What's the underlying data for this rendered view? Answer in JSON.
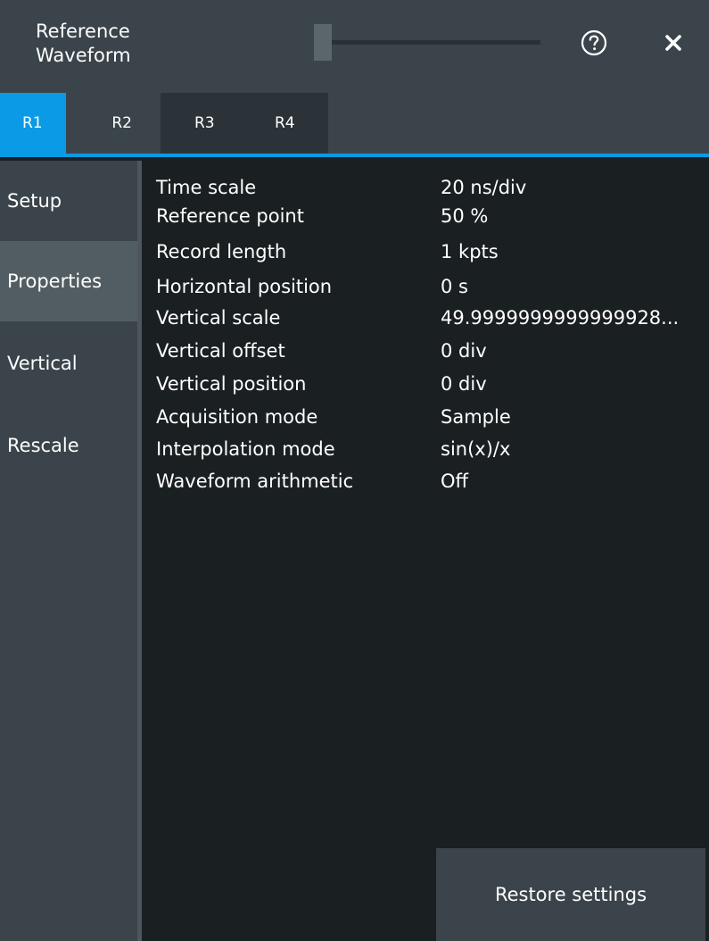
{
  "window": {
    "title_line1": "Reference",
    "title_line2": "Waveform",
    "help_icon": "help-circle-icon",
    "close_icon": "close-icon"
  },
  "tabs": [
    {
      "label": "R1",
      "active": true
    },
    {
      "label": "R2",
      "active": false
    },
    {
      "label": "R3",
      "active": false
    },
    {
      "label": "R4",
      "active": false
    }
  ],
  "colors": {
    "accent": "#0a9ae6",
    "panel": "#3a444a",
    "background": "#1a1f22",
    "active_side": "#525d63"
  },
  "sidebar": {
    "items": [
      {
        "label": "Setup",
        "active": false
      },
      {
        "label": "Properties",
        "active": true
      },
      {
        "label": "Vertical",
        "active": false
      },
      {
        "label": "Rescale",
        "active": false
      }
    ]
  },
  "properties": [
    {
      "label": "Time scale",
      "value": "20 ns/div"
    },
    {
      "label": "Reference point",
      "value": "50 %"
    },
    {
      "label": "Record length",
      "value": "1 kpts"
    },
    {
      "label": "Horizontal position",
      "value": "0 s"
    },
    {
      "label": "Vertical scale",
      "value": "49.9999999999999928..."
    },
    {
      "label": "Vertical offset",
      "value": "0 div"
    },
    {
      "label": "Vertical position",
      "value": "0 div"
    },
    {
      "label": "Acquisition mode",
      "value": "Sample"
    },
    {
      "label": "Interpolation mode",
      "value": "sin(x)/x"
    },
    {
      "label": "Waveform arithmetic",
      "value": "Off"
    }
  ],
  "footer": {
    "restore_label": "Restore settings"
  }
}
